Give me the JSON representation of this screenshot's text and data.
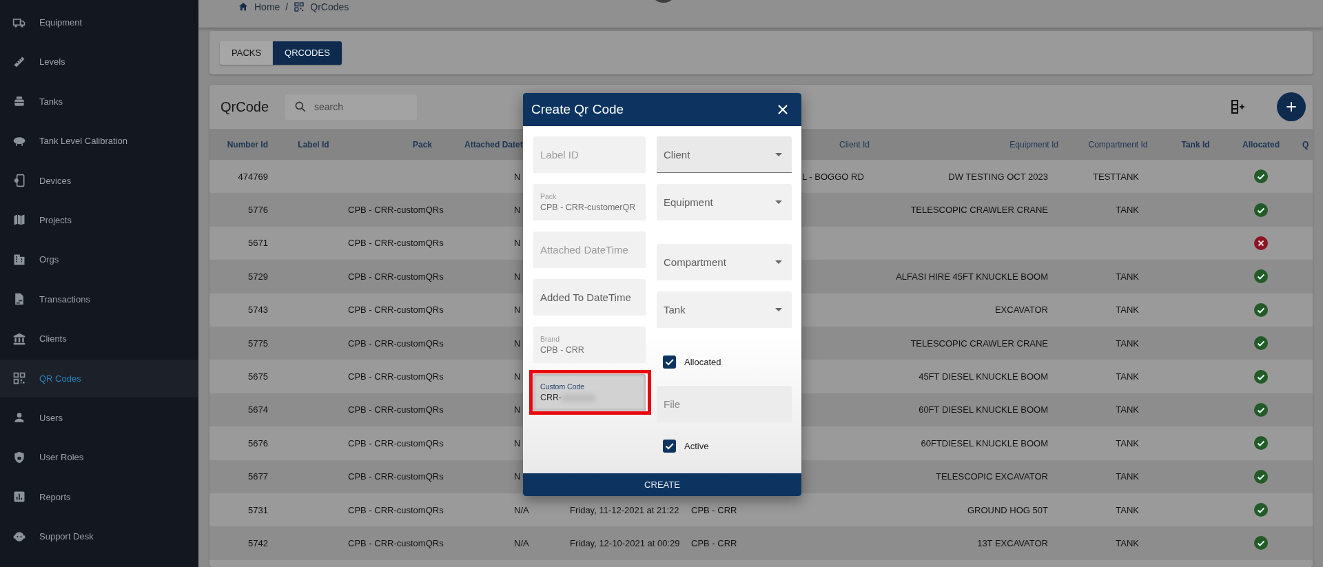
{
  "breadcrumb": [
    {
      "label": "Home"
    },
    {
      "label": "QrCodes"
    }
  ],
  "breadcrumb_separator": "/",
  "sidebar": {
    "items": [
      {
        "label": "Equipment",
        "selected": false
      },
      {
        "label": "Levels",
        "selected": false
      },
      {
        "label": "Tanks",
        "selected": false
      },
      {
        "label": "Tank Level Calibration",
        "selected": false
      },
      {
        "label": "Devices",
        "selected": false
      },
      {
        "label": "Projects",
        "selected": false
      },
      {
        "label": "Orgs",
        "selected": false
      },
      {
        "label": "Transactions",
        "selected": false
      },
      {
        "label": "Clients",
        "selected": false
      },
      {
        "label": "QR Codes",
        "selected": true
      },
      {
        "label": "Users",
        "selected": false
      },
      {
        "label": "User Roles",
        "selected": false
      },
      {
        "label": "Reports",
        "selected": false
      },
      {
        "label": "Support Desk",
        "selected": false
      }
    ]
  },
  "tabs": [
    {
      "label": "PACKS",
      "selected": false
    },
    {
      "label": "QRCODES",
      "selected": true
    }
  ],
  "table": {
    "title": "QrCode",
    "search": {
      "placeholder": "search"
    },
    "columns": [
      "Number Id",
      "Label Id",
      "Pack",
      "Attached Datet",
      "Client Id",
      "Equipment Id",
      "Compartment Id",
      "Tank Id",
      "Allocated",
      "Q"
    ],
    "rows": [
      {
        "number_id": "474769",
        "attached_datetime": "N",
        "client_id": "L - BOGGO RD",
        "equipment_id": "DW TESTING OCT 2023",
        "compartment_id": "TESTTANK",
        "allocated": true
      },
      {
        "number_id": "5776",
        "pack": "CPB - CRR-customQRs",
        "attached_datetime": "N",
        "equipment_id": "TELESCOPIC CRAWLER CRANE",
        "compartment_id": "TANK",
        "allocated": true
      },
      {
        "number_id": "5671",
        "pack": "CPB - CRR-customQRs",
        "attached_datetime": "N",
        "allocated": false
      },
      {
        "number_id": "5729",
        "pack": "CPB - CRR-customQRs",
        "attached_datetime": "N",
        "equipment_id": "ALFASI HIRE 45FT KNUCKLE BOOM",
        "compartment_id": "TANK",
        "allocated": true
      },
      {
        "number_id": "5743",
        "pack": "CPB - CRR-customQRs",
        "attached_datetime": "N",
        "equipment_id": "EXCAVATOR",
        "compartment_id": "TANK",
        "allocated": true
      },
      {
        "number_id": "5775",
        "pack": "CPB - CRR-customQRs",
        "attached_datetime": "N",
        "equipment_id": "TELESCOPIC CRAWLER CRANE",
        "compartment_id": "TANK",
        "allocated": true
      },
      {
        "number_id": "5675",
        "pack": "CPB - CRR-customQRs",
        "attached_datetime": "N",
        "equipment_id": "45FT DIESEL KNUCKLE BOOM",
        "compartment_id": "TANK",
        "allocated": true
      },
      {
        "number_id": "5674",
        "pack": "CPB - CRR-customQRs",
        "attached_datetime": "N",
        "equipment_id": "60FT DIESEL KNUCKLE BOOM",
        "compartment_id": "TANK",
        "allocated": true
      },
      {
        "number_id": "5676",
        "pack": "CPB - CRR-customQRs",
        "attached_datetime": "N",
        "equipment_id": "60FTDIESEL KNUCKLE BOOM",
        "compartment_id": "TANK",
        "allocated": true
      },
      {
        "number_id": "5677",
        "pack": "CPB - CRR-customQRs",
        "attached_datetime": "N",
        "equipment_id": "TELESCOPIC EXCAVATOR",
        "compartment_id": "TANK",
        "allocated": true
      },
      {
        "number_id": "5731",
        "pack": "CPB - CRR-customQRs",
        "attached_datetime": "N/A",
        "column_5": "Friday, 11-12-2021 at 21:22",
        "column_6": "CPB - CRR",
        "equipment_id": "GROUND HOG 50T",
        "compartment_id": "TANK",
        "allocated": true
      },
      {
        "number_id": "5742",
        "pack": "CPB - CRR-customQRs",
        "attached_datetime": "N/A",
        "column_5": "Friday, 12-10-2021 at 00:29",
        "column_6": "CPB - CRR",
        "equipment_id": "13T EXCAVATOR",
        "compartment_id": "TANK",
        "allocated": true
      }
    ]
  },
  "dialog": {
    "title": "Create Qr Code",
    "left_fields": [
      {
        "kind": "placeholder",
        "placeholder": "Label ID"
      },
      {
        "kind": "readonly",
        "label": "Pack",
        "value": "CPB - CRR-customerQR"
      },
      {
        "kind": "placeholder",
        "placeholder": "Attached DateTime"
      },
      {
        "kind": "label",
        "label": "Added To DateTime"
      },
      {
        "kind": "readonly",
        "label": "Brand",
        "value": "CPB - CRR"
      },
      {
        "kind": "highlighted",
        "label": "Custom Code",
        "value": "CRR-"
      }
    ],
    "right_fields": [
      {
        "kind": "select",
        "label": "Client",
        "focused": true
      },
      {
        "kind": "select",
        "label": "Equipment",
        "focused": false
      },
      {
        "kind": "select",
        "label": "Compartment",
        "focused": false
      },
      {
        "kind": "select",
        "label": "Tank",
        "focused": false
      },
      {
        "kind": "checkbox",
        "label": "Allocated",
        "checked": true
      },
      {
        "kind": "file",
        "placeholder": "File"
      },
      {
        "kind": "checkbox",
        "label": "Active",
        "checked": true
      }
    ],
    "button": "CREATE"
  }
}
